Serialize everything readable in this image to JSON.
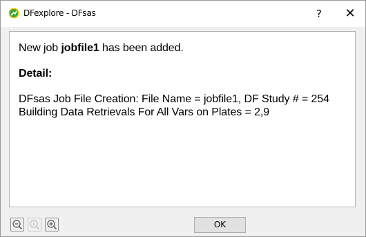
{
  "window": {
    "title": "DFexplore - DFsas",
    "help_label": "?",
    "close_label": "✕",
    "app_icon": "dfexplore-logo-icon"
  },
  "message": {
    "prefix": "New job ",
    "job_name": "jobfile1",
    "suffix": " has been added.",
    "detail_heading": "Detail:",
    "detail_line1": "DFsas Job File Creation: File Name = jobfile1, DF Study # = 254",
    "detail_line2": "Building Data Retrievals For All Vars on Plates = 2,9"
  },
  "toolbar": {
    "zoom_out_icon": "zoom-out-icon",
    "zoom_reset_icon": "zoom-reset-icon",
    "zoom_in_icon": "zoom-in-icon",
    "ok_label": "OK"
  },
  "colors": {
    "logo_green": "#3da53a",
    "logo_ring": "#f2c200"
  }
}
